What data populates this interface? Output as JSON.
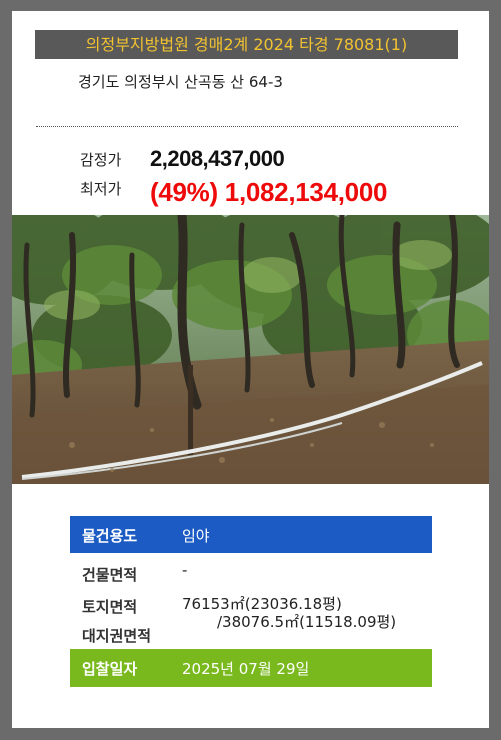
{
  "header": {
    "title": "의정부지방법원 경매2계 2024 타경 78081(1)",
    "address": "경기도 의정부시 산곡동 산 64-3"
  },
  "price": {
    "appraisal_label": "감정가",
    "appraisal_value": "2,208,437,000",
    "minimum_label": "최저가",
    "minimum_value": "(49%) 1,082,134,000"
  },
  "photo": {
    "description_icon": "forest-photo"
  },
  "details": {
    "usage_label": "물건용도",
    "usage_value": "임야",
    "building_area_label": "건물면적",
    "building_area_value": "-",
    "land_area_label": "토지면적",
    "land_area_value_1": "76153㎡(23036.18평)",
    "land_area_value_2": "/38076.5㎡(11518.09평)",
    "land_right_label": "대지권면적",
    "bid_date_label": "입찰일자",
    "bid_date_value": "2025년 07월 29일"
  },
  "colors": {
    "background": "#6b6b6b",
    "title_bar": "#595959",
    "title_text": "#f2c230",
    "min_price": "#ee0a0a",
    "usage_bar": "#1c5bc4",
    "bid_bar": "#79b91e"
  }
}
